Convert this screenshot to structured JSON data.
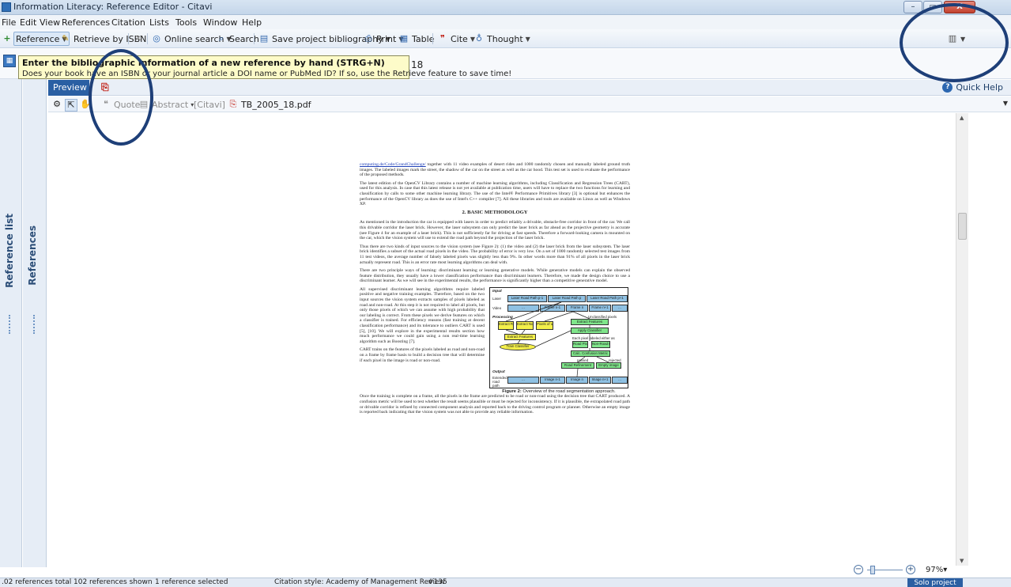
{
  "window": {
    "title": "Information Literacy: Reference Editor - Citavi",
    "minimize": "–",
    "maximize": "▭",
    "close": "X"
  },
  "menu": [
    "File",
    "Edit",
    "View",
    "References",
    "Citation",
    "Lists",
    "Tools",
    "Window",
    "Help"
  ],
  "toolbar": {
    "reference": "Reference",
    "retrieve_isbn": "Retrieve by ISBN",
    "online_search": "Online search",
    "search": "Search",
    "save_bibliography": "Save project bibliography",
    "print": "Print",
    "table": "Table",
    "cite": "Cite",
    "thought": "Thought"
  },
  "field_row": {
    "value_fragment": "18"
  },
  "tooltip": {
    "title": "Enter the bibliographic information of a new reference by hand (STRG+N)",
    "text": "Does your book have an ISBN or your journal article a DOI name or PubMed ID? If so, use the Retrieve feature to save time!"
  },
  "side_tabs": {
    "reference_list": "Reference list",
    "references": "References"
  },
  "preview": {
    "tab": "Preview",
    "quick_help": "Quick Help",
    "quote": "Quote",
    "abstract": "Abstract",
    "citavi_label": "[Citavi]",
    "file_name": "TB_2005_18.pdf"
  },
  "document": {
    "p1_link": "computing.de/Code/GrandChallenge/",
    "p1_rest": " together with 11 video examples of desert rides and 1000 randomly chosen and manually labeled ground truth images. The labeled images mark the street, the shadow of the car on the street as well as the car hood. This test set is used to evaluate the performance of the proposed methods.",
    "p2": "The latest edition of the OpenCV Library contains a number of machine learning algorithms, including Classification and Regression Trees (CART), used for this analysis. In case that this latest release is not yet available at publication time, users will have to replace the two functions for learning and classification by calls to some other machine learning library. The use of the Intel® Performance Primitives library [3] is optional but enhances the performance of the OpenCV library as does the use of Intel's C++ compiler [7]. All these libraries and tools are available on Linux as well as Windows XP.",
    "heading": "2.  BASIC METHODOLOGY",
    "p3": "As mentioned in the introduction the car is equipped with lasers in order to predict reliably a drivable, obstacle-free corridor in front of the car. We call this drivable corridor the laser brick. However, the laser subsystem can only predict the laser brick as far ahead as the projective geometry is accurate (see Figure 4 for an example of a laser brick). This is not sufficiently far for driving at fast speeds. Therefore a forward-looking camera is mounted on the car, which the vision system will use to extend the road path beyond the projection of the laser brick.",
    "p4": "Thus there are two kinds of input sources to the vision system (see Figure 2):  (1) the video and (2) the laser brick from the laser subsystem. The laser brick identifies a subset of the actual road pixels in the video. The probability of error is very low. On a set of 1000 randomly selected test images from 11 test videos, the average number of falsely labeled pixels was slightly less than 9%. In other words more than 91% of all pixels in the laser brick actually represent road. This is an error rate most learning algorithms can deal with.",
    "p5": "There are two principle ways of learning: discriminant learning or learning generative models. While generative models can explain the observed feature distribution, they usually have a lower classification performance than discriminant learners. Therefore, we made the design choice to use a discriminant learner. As we will see in the experimental results, the performance is significantly higher than a competitive generative model.",
    "p6": "All supervised discriminant learning algorithms require labeled positive and negative training examples. Therefore, based on the two input sources the vision system extracts samples of pixels labeled as road and non-road. At this step it is not required to label all pixels, but only those pixels of which we can assume with high probability that our labeling is correct. From these pixels we derive features on which a classifier is trained. For efficiency reasons (fast training at decent classification performance) and its tolerance to outliers CART is used [5], [10]. We will explore in the experimental results section how much performance we could gain using a non real-time learning algorithm such as Boosting [7].",
    "p7": "CART trains on the features of the pixels labeled as road and non-road on a frame by frame basis to build a decision tree that will determine if each pixel in the image is road or non-road.",
    "p8": "Once the training is complete on a frame, all the pixels in the frame are predicted to be road or non-road using the decision tree that CART produced. A confusion metric will be used to test whether the result seems plausible or must be rejected for inconsistency. If it is plausible, the extrapolated road path or drivable corridor is refined by connected component analysis and reported back to the driving control program or planner. Otherwise an empty image is reported back indicating that the vision system was not able to provide any reliable information.",
    "figure": {
      "input": "Input",
      "laser": "Laser",
      "video": "Video",
      "processing": "Processing",
      "output": "Output",
      "extended": "Extended road path",
      "laser_boxes": [
        "Laser Road Path p-1",
        "Laser Road Path p",
        "Laser Road Path p+1"
      ],
      "frame_boxes": [
        "…",
        "Frame n-1",
        "Frame n",
        "Frame n+1",
        "…"
      ],
      "extract_road": "Extract Road Pixels",
      "extract_nonroad": "Extract Non Road Pixels",
      "pixels_unknown": "Pixels of unknown class",
      "extract_features_left": "Extract Features",
      "train_classifier": "Train Classifier",
      "unclassified": "Unclassified pixels",
      "extract_features_right": "Extract Features",
      "apply_classifier": "Apply Classifier",
      "each_pixel": "Each pixel labeled either as",
      "road_pixels": "Road Pixels",
      "non_road_pixels": "Non-Road Pixels",
      "calc_confusion": "Calc. Confusion Metric",
      "passed": "passed",
      "rejected": "rejected",
      "road_refinement": "Road Refinement",
      "empty_image": "Empty image",
      "image_boxes": [
        "…",
        "Image n-1",
        "Image n",
        "Image n+1",
        "…"
      ],
      "caption_bold": "Figure 2:",
      "caption_text": " Overview of the road segmentation approach."
    }
  },
  "zoom": {
    "value": "97%"
  },
  "status": {
    "total": ".02 references total",
    "shown": "102 references shown",
    "selected": "1 reference selected",
    "citation_style": "Citation style: Academy of Management Review",
    "number": "#135",
    "solo": "Solo project"
  }
}
